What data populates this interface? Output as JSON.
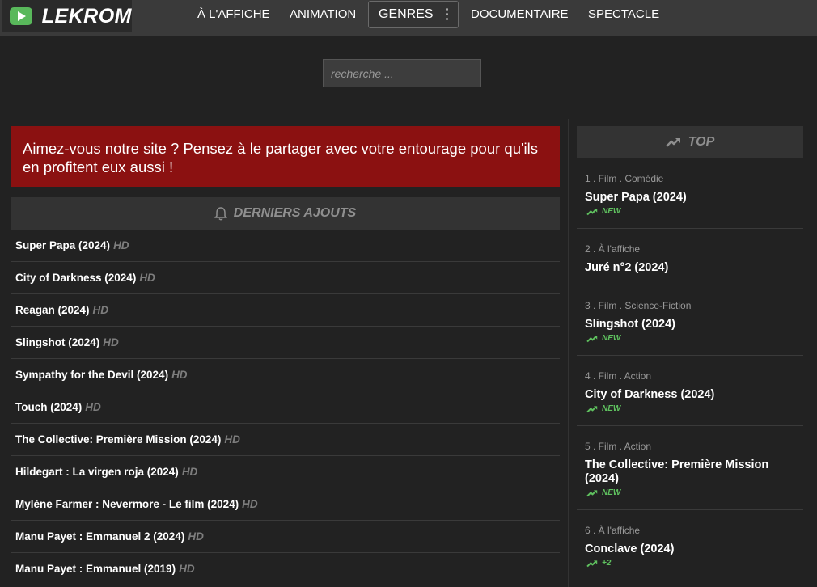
{
  "brand": {
    "name": "LEKROM"
  },
  "nav": {
    "items": [
      "À L'AFFICHE",
      "ANIMATION",
      "DOCUMENTAIRE",
      "SPECTACLE"
    ],
    "genres_label": "GENRES"
  },
  "search": {
    "placeholder": "recherche ..."
  },
  "banner": {
    "text": "Aimez-vous notre site ? Pensez à le partager avec votre entourage pour qu'ils en profitent eux aussi !"
  },
  "latest": {
    "heading": "DERNIERS AJOUTS",
    "items": [
      {
        "title": "Super Papa (2024)",
        "quality": "HD"
      },
      {
        "title": "City of Darkness (2024)",
        "quality": "HD"
      },
      {
        "title": "Reagan (2024)",
        "quality": "HD"
      },
      {
        "title": "Slingshot (2024)",
        "quality": "HD"
      },
      {
        "title": "Sympathy for the Devil (2024)",
        "quality": "HD"
      },
      {
        "title": "Touch (2024)",
        "quality": "HD"
      },
      {
        "title": "The Collective: Première Mission (2024)",
        "quality": "HD"
      },
      {
        "title": "Hildegart : La virgen roja (2024)",
        "quality": "HD"
      },
      {
        "title": "Mylène Farmer : Nevermore - Le film (2024)",
        "quality": "HD"
      },
      {
        "title": "Manu Payet : Emmanuel 2 (2024)",
        "quality": "HD"
      },
      {
        "title": "Manu Payet : Emmanuel (2019)",
        "quality": "HD"
      }
    ]
  },
  "top": {
    "heading": "TOP",
    "items": [
      {
        "meta": "1 . Film . Comédie",
        "title": "Super Papa (2024)",
        "badge": "NEW"
      },
      {
        "meta": "2 . À l'affiche",
        "title": "Juré n°2 (2024)",
        "badge": ""
      },
      {
        "meta": "3 . Film . Science-Fiction",
        "title": "Slingshot (2024)",
        "badge": "NEW"
      },
      {
        "meta": "4 . Film . Action",
        "title": "City of Darkness (2024)",
        "badge": "NEW"
      },
      {
        "meta": "5 . Film . Action",
        "title": "The Collective: Première Mission (2024)",
        "badge": "NEW"
      },
      {
        "meta": "6 . À l'affiche",
        "title": "Conclave (2024)",
        "badge": "+2"
      }
    ]
  },
  "colors": {
    "accent": "#8b1111",
    "trend": "#5fc15f",
    "logo_green": "#59b85b"
  }
}
